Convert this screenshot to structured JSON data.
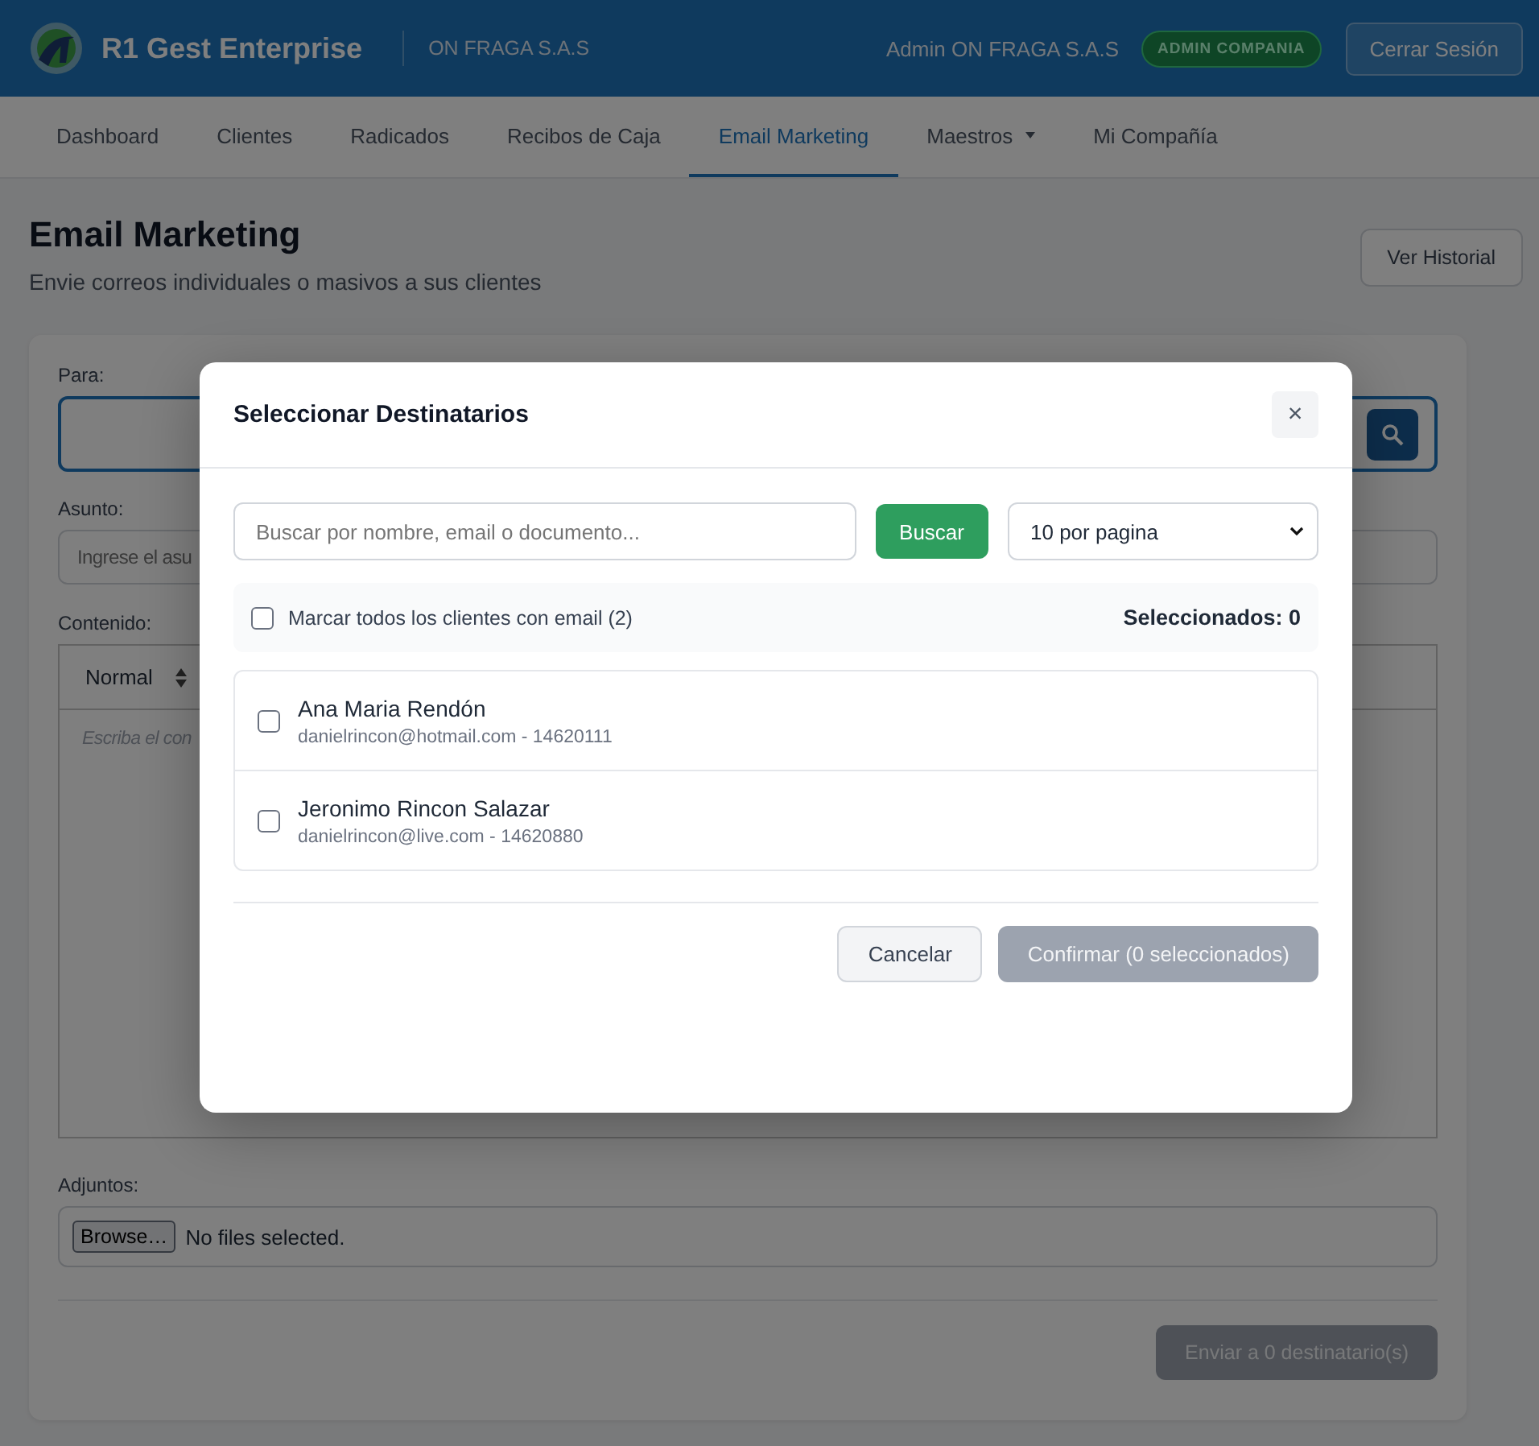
{
  "header": {
    "brand": "R1 Gest Enterprise",
    "company": "ON FRAGA S.A.S",
    "user": "Admin ON FRAGA S.A.S",
    "role_badge": "ADMIN COMPANIA",
    "logout": "Cerrar Sesión"
  },
  "nav": {
    "items": [
      {
        "label": "Dashboard",
        "kind": "link",
        "selected": false
      },
      {
        "label": "Clientes",
        "kind": "link",
        "selected": false
      },
      {
        "label": "Radicados",
        "kind": "link",
        "selected": false
      },
      {
        "label": "Recibos de Caja",
        "kind": "link",
        "selected": false
      },
      {
        "label": "Email Marketing",
        "kind": "link",
        "selected": true
      },
      {
        "label": "Maestros",
        "kind": "dropdown",
        "selected": false
      },
      {
        "label": "Mi Compañía",
        "kind": "link",
        "selected": false
      }
    ]
  },
  "page": {
    "title": "Email Marketing",
    "subtitle": "Envie correos individuales o masivos a sus clientes",
    "history_button": "Ver Historial"
  },
  "form": {
    "to_label": "Para:",
    "subject_label": "Asunto:",
    "subject_placeholder": "Ingrese el asu",
    "content_label": "Contenido:",
    "format_select": "Normal",
    "editor_placeholder": "Escriba el con",
    "attachments_label": "Adjuntos:",
    "file_button": "Browse…",
    "file_status": "No files selected.",
    "send_button": {
      "label": "Enviar a 0 destinatario(s)",
      "disabled": true
    }
  },
  "modal": {
    "title": "Seleccionar Destinatarios",
    "close": "×",
    "search_placeholder": "Buscar por nombre, email o documento...",
    "search_button": "Buscar",
    "page_size": "10 por pagina",
    "select_all": {
      "label": "Marcar todos los clientes con email (2)",
      "checked": false
    },
    "selected_count": "Seleccionados: 0",
    "clients": [
      {
        "name": "Ana Maria Rendón",
        "detail": "danielrincon@hotmail.com - 14620111",
        "checked": false
      },
      {
        "name": "Jeronimo Rincon Salazar",
        "detail": "danielrincon@live.com - 14620880",
        "checked": false
      }
    ],
    "cancel": "Cancelar",
    "confirm": {
      "label": "Confirmar (0 seleccionados)",
      "disabled": true
    }
  }
}
